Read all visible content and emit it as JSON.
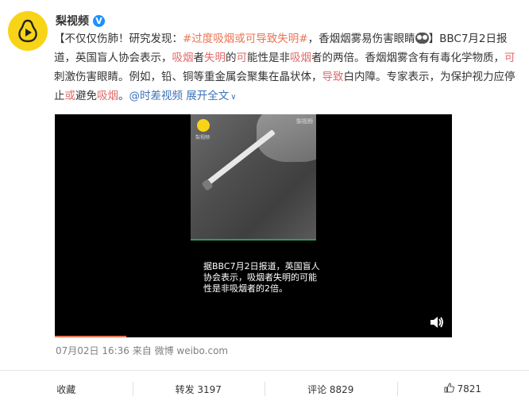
{
  "author": {
    "name": "梨视频",
    "verified_badge": "V"
  },
  "post": {
    "segments": [
      {
        "text": "【不仅仅伤肺！研究发现：",
        "style": "plain"
      },
      {
        "text": "#过度吸烟或可导致失明#",
        "style": "link"
      },
      {
        "text": "，香烟烟雾易伤害眼睛",
        "style": "plain"
      },
      {
        "text": "emoji",
        "style": "emoji"
      },
      {
        "text": "】BBC7月2日报道，英国盲人协会表示，",
        "style": "plain"
      },
      {
        "text": "吸烟",
        "style": "hl"
      },
      {
        "text": "者",
        "style": "plain"
      },
      {
        "text": "失明",
        "style": "hl"
      },
      {
        "text": "的",
        "style": "plain"
      },
      {
        "text": "可",
        "style": "hl"
      },
      {
        "text": "能性是非",
        "style": "plain"
      },
      {
        "text": "吸烟",
        "style": "hl"
      },
      {
        "text": "者的两倍。香烟烟雾含有有毒化学物质，",
        "style": "plain"
      },
      {
        "text": "可",
        "style": "hl"
      },
      {
        "text": "刺激伤害眼睛。例如，铅、铜等重金属会聚集在晶状体，",
        "style": "plain"
      },
      {
        "text": "导致",
        "style": "hl"
      },
      {
        "text": "白内障。专家表示，为保护视力应停止",
        "style": "plain"
      },
      {
        "text": "或",
        "style": "hl"
      },
      {
        "text": "避免",
        "style": "plain"
      },
      {
        "text": "吸烟",
        "style": "hl"
      },
      {
        "text": "。",
        "style": "plain"
      },
      {
        "text": "@时差视频",
        "style": "mention"
      },
      {
        "text": " ",
        "style": "plain"
      },
      {
        "text": "展开全文",
        "style": "expand"
      }
    ]
  },
  "video": {
    "frame_label": "梨视频",
    "frame_watermark": "梨视频",
    "subtitle": "据BBC7月2日报道，英国盲人协会表示，吸烟者失明的可能性是非吸烟者的2倍。",
    "progress": 0.18
  },
  "meta": {
    "text": "07月02日 16:36 来自 微博 weibo.com"
  },
  "actions": {
    "favorite": "收藏",
    "repost": "转发 3197",
    "comment": "评论 8829",
    "like": "7821"
  },
  "colors": {
    "accent": "#eb7350",
    "highlight": "#e06a6a",
    "mention": "#3b73b8",
    "brand_yellow": "#f7d417"
  }
}
